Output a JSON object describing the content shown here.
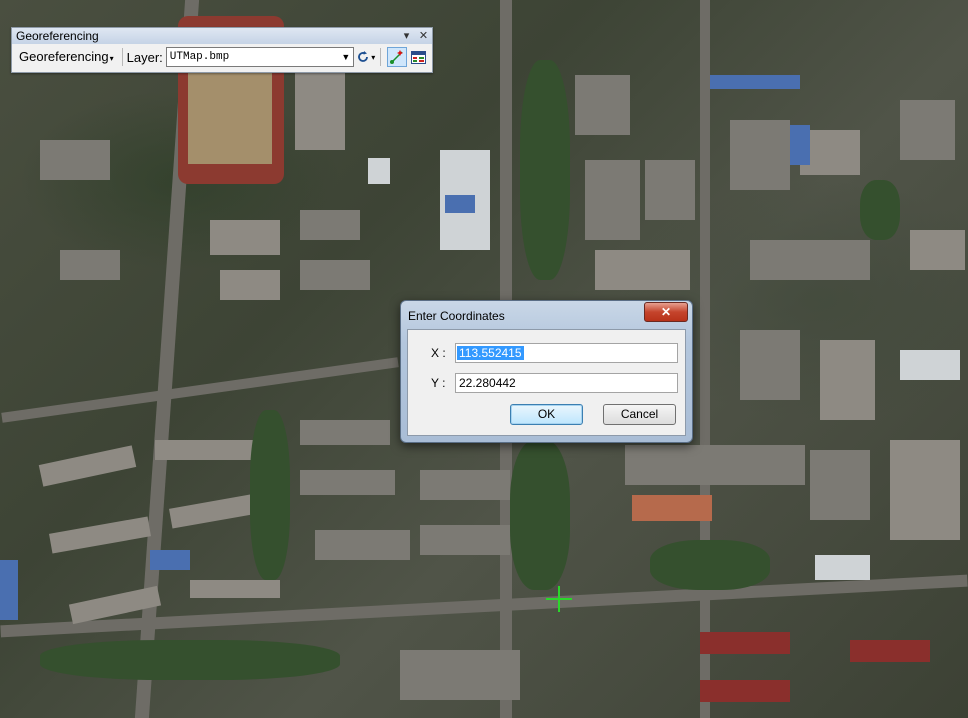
{
  "toolbar": {
    "title": "Georeferencing",
    "menu_label": "Georeferencing",
    "layer_label": "Layer:",
    "layer_value": "UTMap.bmp",
    "buttons": [
      "rotate-tool",
      "add-control-points",
      "view-link-table"
    ]
  },
  "dialog": {
    "title": "Enter Coordinates",
    "x_label": "X :",
    "x_value": "113.552415",
    "y_label": "Y :",
    "y_value": "22.280442",
    "ok_label": "OK",
    "cancel_label": "Cancel"
  },
  "colors": {
    "crosshair": "#2bd62b",
    "selection": "#3399ff",
    "close_button": "#c5442c"
  },
  "icons": {
    "close": "close-icon",
    "rotate": "rotate-icon",
    "add_control_points": "add-control-points-icon",
    "link_table": "link-table-icon"
  }
}
